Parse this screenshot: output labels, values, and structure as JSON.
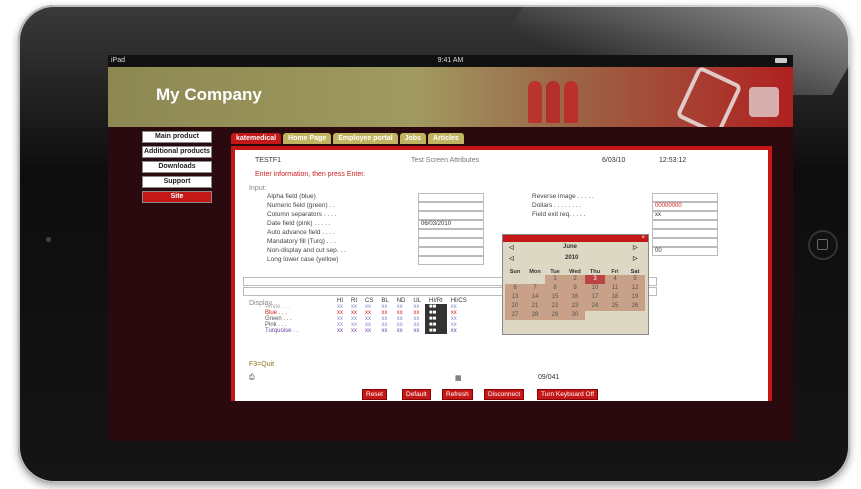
{
  "status": {
    "carrier": "iPad",
    "time": "9:41 AM"
  },
  "company": "My Company",
  "nav": [
    {
      "label": "Main product",
      "selected": false
    },
    {
      "label": "Additional products",
      "selected": false
    },
    {
      "label": "Downloads",
      "selected": false
    },
    {
      "label": "Support",
      "selected": false
    },
    {
      "label": "Site",
      "selected": true
    }
  ],
  "tabs": [
    {
      "label": "katemedical",
      "selected": true
    },
    {
      "label": "Home Page",
      "selected": false
    },
    {
      "label": "Employee portal",
      "selected": false
    },
    {
      "label": "Jobs",
      "selected": false
    },
    {
      "label": "Articles",
      "selected": false
    }
  ],
  "screen": {
    "code": "TESTF1",
    "title": "Test Screen Attributes",
    "date": "6/03/10",
    "time": "12:53:12",
    "instruction": "Enter information, then press Enter.",
    "input_heading": "Input:",
    "fields_left": [
      {
        "label": "Alpha field (blue)",
        "value": ""
      },
      {
        "label": "Numeric field (green) . .",
        "value": ""
      },
      {
        "label": "Column separators . . . .",
        "value": ""
      },
      {
        "label": "Date field (pink) . . . . .",
        "value": "06/03/2010"
      },
      {
        "label": "Auto advance field . . . .",
        "value": ""
      },
      {
        "label": "Mandatory fill (Turq) . . .",
        "value": ""
      },
      {
        "label": "Non-display and cut sep. . .",
        "value": ""
      },
      {
        "label": "Long lower case (yellow)",
        "value": ""
      }
    ],
    "fields_right": [
      {
        "label": "Reverse image . . . . .",
        "value": ""
      },
      {
        "label": "Dollars . . . . . . . .",
        "value": "00000000"
      },
      {
        "label": "Field exit req. . . . .",
        "value": "xx"
      },
      {
        "label": "",
        "value": ""
      },
      {
        "label": "",
        "value": ""
      },
      {
        "label": "",
        "value": ""
      },
      {
        "label": "",
        "value": "00"
      }
    ],
    "display_heading": "Display",
    "display_cols": [
      "HI",
      "RI",
      "CS",
      "BL",
      "ND",
      "UL",
      "HI/RI",
      "HI/CS"
    ],
    "display_rows": [
      {
        "label": "White . . .",
        "color": "#aaa"
      },
      {
        "label": "Blue . . .",
        "color": "#d02020"
      },
      {
        "label": "Green . . .",
        "color": "#555"
      },
      {
        "label": "Pink . . .",
        "color": "#555"
      },
      {
        "label": "Turquoise . .",
        "color": "#7040a0"
      }
    ],
    "cell": "xx",
    "cell_box": "■■",
    "footer_key": "F3=Quit",
    "counter": "09/041",
    "buttons": [
      "Reset",
      "Default",
      "Refresh",
      "Disconnect",
      "Turn Keyboard Off"
    ]
  },
  "calendar": {
    "month": "June",
    "year": "2010",
    "weekdays": [
      "Sun",
      "Mon",
      "Tue",
      "Wed",
      "Thu",
      "Fri",
      "Sat"
    ],
    "weeks": [
      [
        "",
        "",
        "1",
        "2",
        "3",
        "4",
        "5"
      ],
      [
        "6",
        "7",
        "8",
        "9",
        "10",
        "11",
        "12"
      ],
      [
        "13",
        "14",
        "15",
        "16",
        "17",
        "18",
        "19"
      ],
      [
        "20",
        "21",
        "22",
        "23",
        "24",
        "25",
        "26"
      ],
      [
        "27",
        "28",
        "29",
        "30",
        "",
        "",
        ""
      ]
    ],
    "selected_day": "3"
  },
  "colors": {
    "accent": "#c41818",
    "tab": "#c0b460",
    "banner": "#8d8852",
    "frame": "#151515"
  }
}
